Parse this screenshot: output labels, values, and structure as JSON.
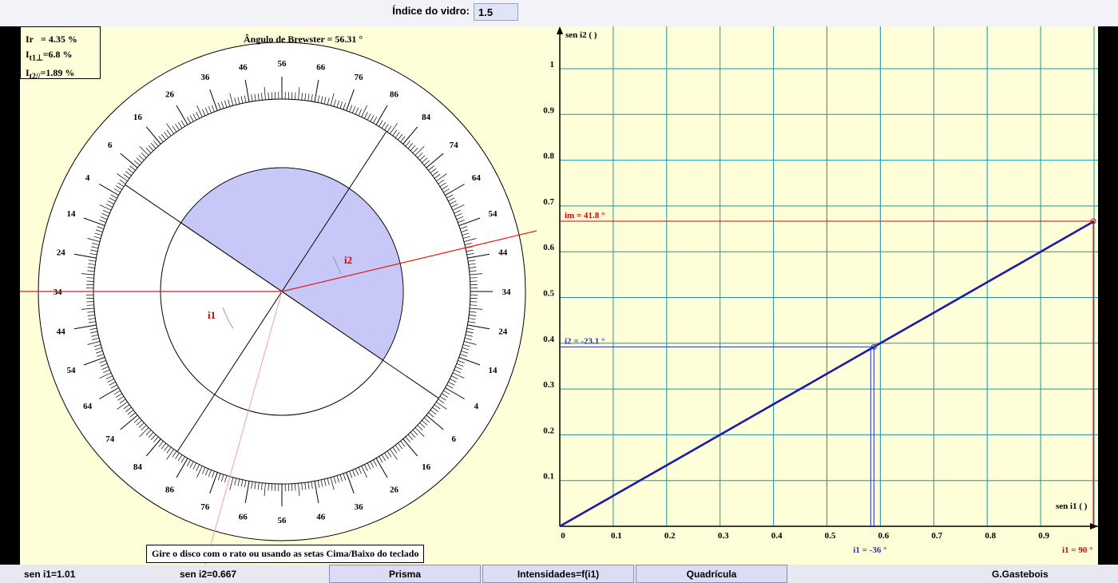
{
  "header": {
    "glass_index_label": "Índice do vidro:",
    "glass_index_value": "1.5"
  },
  "intensities": {
    "ir_label": "Ir",
    "ir_value": "= 4.35 %",
    "it1_label": "I",
    "it1_sub": "t1⊥",
    "it1_value": "=6.8 %",
    "it2_label": "I",
    "it2_sub": "t2//",
    "it2_value": "=1.89 %"
  },
  "disc": {
    "brewster_label": "Ângulo de Brewster = 56.31 °",
    "i1_label": "i1",
    "i2_label": "i2",
    "hint": "Gire o disco com o rato ou usando as setas Cima/Baixo do teclado"
  },
  "graph": {
    "y_axis_title": "sen i2 (  )",
    "x_axis_title": "sen i1 (  )",
    "y_ticks": [
      "0.1",
      "0.2",
      "0.3",
      "0.4",
      "0.5",
      "0.6",
      "0.7",
      "0.8",
      "0.9",
      "1"
    ],
    "x_ticks": [
      "0",
      "0.1",
      "0.2",
      "0.3",
      "0.4",
      "0.5",
      "0.6",
      "0.7",
      "0.8",
      "0.9"
    ],
    "im_label": "im = 41.8 °",
    "i2_marker_label": "i2 = -23.1 °",
    "i1_marker_label": "i1 = -36 °",
    "i1_max_label": "i1 = 90 °",
    "accent_colors": {
      "curve": "#1a1aa8",
      "limit": "#e00000",
      "grid": "#1896a8",
      "marker": "#2233bb"
    }
  },
  "chart_data": {
    "type": "line",
    "title": "",
    "xlabel": "sen i1 (  )",
    "ylabel": "sen i2 (  )",
    "xlim": [
      0,
      1
    ],
    "ylim": [
      0,
      1.1
    ],
    "x": [
      0,
      0.1,
      0.2,
      0.3,
      0.4,
      0.5,
      0.6,
      0.7,
      0.8,
      0.9,
      1.0
    ],
    "series": [
      {
        "values": [
          0,
          0.0667,
          0.1333,
          0.2,
          0.2667,
          0.3333,
          0.4,
          0.4667,
          0.5333,
          0.6,
          0.6667
        ]
      }
    ],
    "markers": {
      "current_point": {
        "x": 0.588,
        "y": 0.392
      },
      "limit_point": {
        "x": 1.0,
        "y": 0.6667
      }
    },
    "grid": true
  },
  "footer": {
    "sen_i1": "sen i1=1.01",
    "sen_i2": "sen i2=0.667",
    "btn_prism": "Prisma",
    "btn_intensities": "Intensidades=f(i1)",
    "btn_grid": "Quadrícula",
    "author": "G.Gastebois"
  }
}
